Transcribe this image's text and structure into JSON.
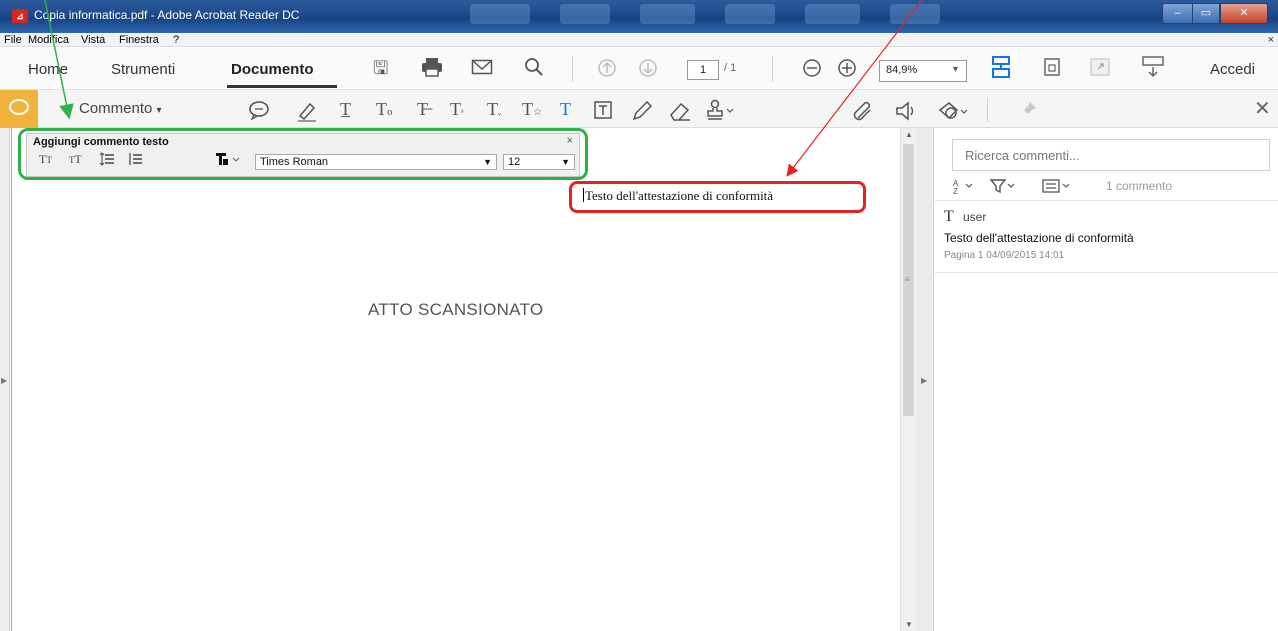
{
  "window": {
    "title": "Copia informatica.pdf - Adobe Acrobat Reader DC",
    "app_icon": "acrobat-icon",
    "controls": {
      "minimize": "‒",
      "maximize": "▭",
      "close": "✕"
    }
  },
  "menu": {
    "items": [
      "File",
      "Modifica",
      "Vista",
      "Finestra",
      "?"
    ],
    "close_glyph": "×"
  },
  "toolbar": {
    "tabs": [
      "Home",
      "Strumenti",
      "Documento"
    ],
    "active_tab": "Documento",
    "page_current": "1",
    "page_total": "/ 1",
    "zoom": "84,9%",
    "sign_in": "Accedi",
    "icons": [
      "save-icon",
      "print-icon",
      "email-icon",
      "search-icon",
      "page-up-icon",
      "page-down-icon",
      "zoom-out-icon",
      "zoom-in-icon",
      "page-fit-icon",
      "rotate-icon",
      "full-screen-icon",
      "keyboard-icon"
    ],
    "accent_color": "#1473e6"
  },
  "comment_toolbar": {
    "label": "Commento",
    "dropdown_glyph": "▾",
    "close_glyph": "✕",
    "accent_color": "#f2b33d"
  },
  "text_panel": {
    "title": "Aggiungi commento testo",
    "close_glyph": "×",
    "font": "Times Roman",
    "size": "12"
  },
  "document": {
    "watermark": "ATTO SCANSIONATO",
    "comment_text": "Testo dell'attestazione di conformità"
  },
  "comments_pane": {
    "search_placeholder": "Ricerca commenti...",
    "count": "1 commento",
    "items": [
      {
        "author": "user",
        "text": "Testo dell'attestazione di conformità",
        "meta": "Pagina 1  04/09/2015 14:01"
      }
    ]
  },
  "annotations": {
    "green": "#2fb14a",
    "red": "#e02424"
  }
}
